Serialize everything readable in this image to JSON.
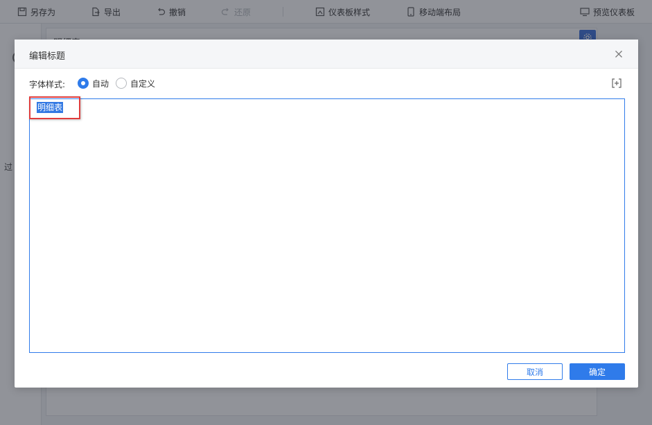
{
  "toolbar": {
    "save_as": "另存为",
    "export": "导出",
    "undo": "撤销",
    "redo": "还原",
    "dashboard_style": "仪表板样式",
    "mobile_layout": "移动端布局",
    "preview_dashboard": "预览仪表板"
  },
  "background": {
    "left_panel_labels": [
      "过"
    ],
    "canvas_title": "明细表"
  },
  "dialog": {
    "title": "编辑标题",
    "font_style_label": "字体样式:",
    "options": [
      {
        "label": "自动",
        "checked": true
      },
      {
        "label": "自定义",
        "checked": false
      }
    ],
    "content": "明细表",
    "cancel_label": "取消",
    "ok_label": "确定"
  },
  "colors": {
    "accent": "#2f7bea",
    "highlight_border": "#e03c3c",
    "overlay": "rgba(35,40,52,0.5)"
  }
}
